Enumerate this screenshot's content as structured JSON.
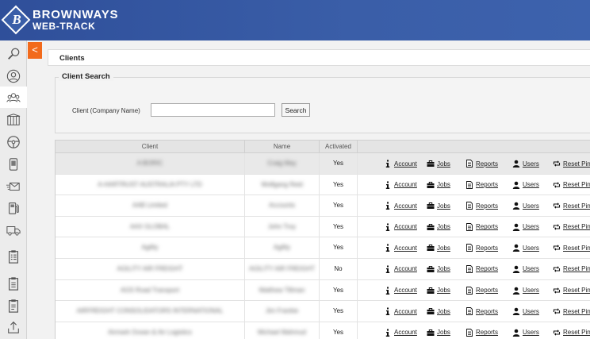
{
  "brand": {
    "line1": "BROWNWAYS",
    "line2": "WEB-TRACK",
    "logo_letter": "B"
  },
  "sidebar": {
    "items": [
      {
        "icon": "search-icon"
      },
      {
        "icon": "user-icon"
      },
      {
        "icon": "users-icon"
      },
      {
        "icon": "warehouse-icon"
      },
      {
        "icon": "steering-wheel-icon"
      },
      {
        "icon": "device-icon"
      },
      {
        "icon": "mail-icon"
      },
      {
        "icon": "fuel-pump-icon"
      },
      {
        "icon": "truck-icon"
      },
      {
        "icon": "clipboard-list-icon"
      },
      {
        "icon": "clipboard-icon"
      },
      {
        "icon": "clipboard-alt-icon"
      },
      {
        "icon": "upload-icon"
      }
    ]
  },
  "collapse": {
    "label": "<"
  },
  "page": {
    "title": "Clients"
  },
  "search": {
    "legend": "Client Search",
    "label": "Client (Company Name)",
    "value": "",
    "placeholder": "",
    "button": "Search"
  },
  "table": {
    "columns": [
      "Client",
      "Name",
      "Activated",
      ""
    ],
    "actions": [
      "Account",
      "Jobs",
      "Reports",
      "Users",
      "Reset Pin"
    ],
    "rows": [
      {
        "client": "A BORIC",
        "name": "Craig May",
        "activated": "Yes"
      },
      {
        "client": "A-HARTRUST AUSTRALIA PTY LTD",
        "name": "Wolfgang Reid",
        "activated": "Yes"
      },
      {
        "client": "AAB Limited",
        "name": "Accounts",
        "activated": "Yes"
      },
      {
        "client": "AAX GLOBAL",
        "name": "John Troy",
        "activated": "Yes"
      },
      {
        "client": "Agility",
        "name": "Agility",
        "activated": "Yes"
      },
      {
        "client": "AGILITY AIR FREIGHT",
        "name": "AGILITY AIR FREIGHT",
        "activated": "No"
      },
      {
        "client": "AGS Road Transport",
        "name": "Matthew Tillman",
        "activated": "Yes"
      },
      {
        "client": "AIRFREIGHT CONSOLIDATORS INTERNATIONAL",
        "name": "Jim Frankie",
        "activated": "Yes"
      },
      {
        "client": "Airmark Ocean & Air Logistics",
        "name": "Michael Mahmud",
        "activated": "Yes"
      }
    ]
  }
}
